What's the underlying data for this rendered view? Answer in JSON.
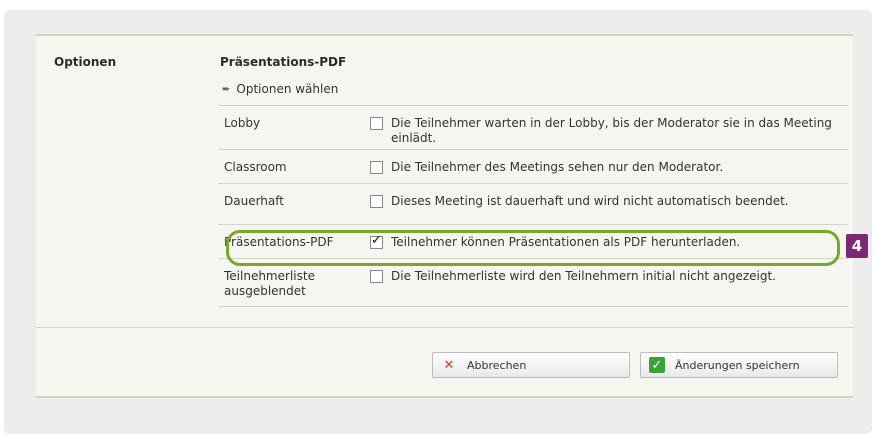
{
  "section": {
    "label": "Optionen",
    "title": "Präsentations-PDF",
    "choose_label": "Optionen wählen"
  },
  "options": [
    {
      "name": "Lobby",
      "checked": false,
      "description": "Die Teilnehmer warten in der Lobby, bis der Moderator sie in das Meeting einlädt."
    },
    {
      "name": "Classroom",
      "checked": false,
      "description": "Die Teilnehmer des Meetings sehen nur den Moderator."
    },
    {
      "name": "Dauerhaft",
      "checked": false,
      "description": "Dieses Meeting ist dauerhaft und wird nicht automatisch beendet."
    },
    {
      "name": "Präsentations-PDF",
      "checked": true,
      "description": "Teilnehmer können Präsentationen als PDF herunterladen."
    },
    {
      "name": "Teilnehmerliste ausgeblendet",
      "checked": false,
      "description": "Die Teilnehmerliste wird den Teilnehmern initial nicht angezeigt."
    }
  ],
  "annotation": {
    "badge": "4",
    "color": "#7aa72a",
    "badge_color": "#7a2a73"
  },
  "buttons": {
    "cancel_label": "Abbrechen",
    "save_label": "Änderungen speichern"
  },
  "icons": {
    "cancel": "close-icon",
    "save": "checkmark-icon",
    "choose": "arrow-right-icon"
  }
}
